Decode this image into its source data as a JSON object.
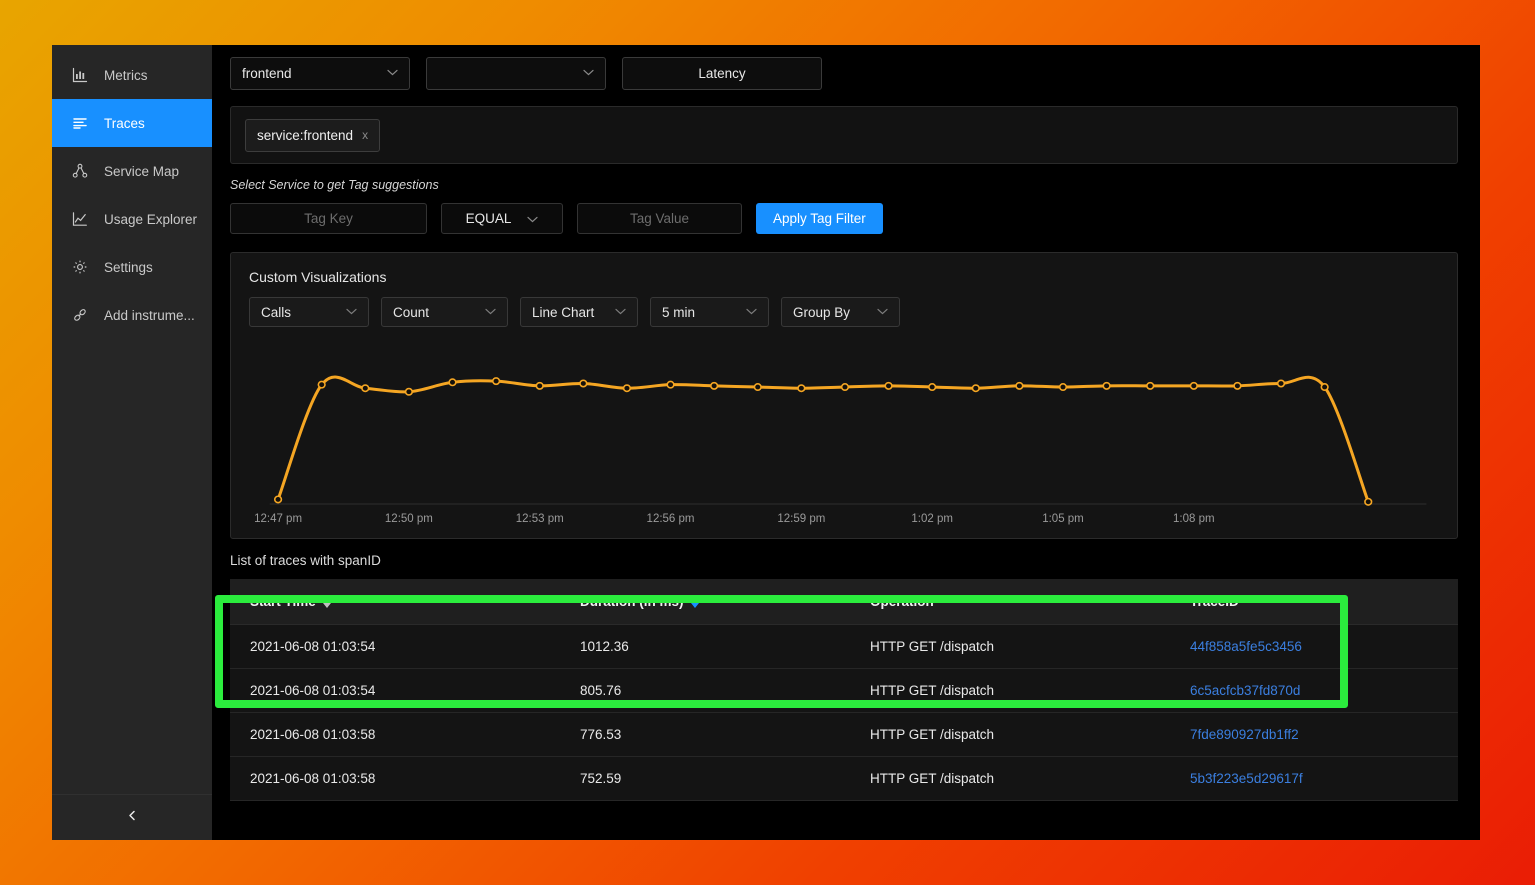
{
  "sidebar": {
    "items": [
      {
        "label": "Metrics",
        "icon": "bar-chart-icon",
        "active": false
      },
      {
        "label": "Traces",
        "icon": "list-lines-icon",
        "active": true
      },
      {
        "label": "Service Map",
        "icon": "node-graph-icon",
        "active": false
      },
      {
        "label": "Usage Explorer",
        "icon": "line-chart-icon",
        "active": false
      },
      {
        "label": "Settings",
        "icon": "gear-icon",
        "active": false
      },
      {
        "label": "Add instrume...",
        "icon": "link-chain-icon",
        "active": false
      }
    ],
    "collapse_icon": "chevron-left-icon"
  },
  "filters": {
    "service_value": "frontend",
    "operation_value": "",
    "latency_label": "Latency",
    "caret_icon": "chevron-down-icon",
    "chips": [
      {
        "label": "service:frontend",
        "close_icon": "x"
      }
    ]
  },
  "tag_filter": {
    "hint": "Select Service to get Tag suggestions",
    "tag_key_placeholder": "Tag Key",
    "tag_key_value": "",
    "operator_value": "EQUAL",
    "tag_value_placeholder": "Tag Value",
    "tag_value_value": "",
    "apply_label": "Apply Tag Filter",
    "apply_color": "#1890ff"
  },
  "visualization": {
    "title": "Custom Visualizations",
    "metric_value": "Calls",
    "aggregate_value": "Count",
    "chart_type_value": "Line Chart",
    "interval_value": "5 min",
    "groupby_value": "Group By"
  },
  "chart_data": {
    "type": "line",
    "title": "",
    "xlabel": "",
    "ylabel": "",
    "line_color": "#f5a623",
    "marker_color": "#f5a623",
    "grid": false,
    "legend": null,
    "xlim": [
      0,
      26
    ],
    "ylim": [
      0,
      12
    ],
    "x_tick_labels": [
      "12:47 pm",
      "12:50 pm",
      "12:53 pm",
      "12:56 pm",
      "12:59 pm",
      "1:02 pm",
      "1:05 pm",
      "1:08 pm"
    ],
    "x_tick_positions": [
      0,
      3,
      6,
      9,
      12,
      15,
      18,
      21
    ],
    "series": [
      {
        "name": "Calls",
        "x": [
          0,
          1,
          2,
          3,
          4,
          5,
          6,
          7,
          8,
          9,
          10,
          11,
          12,
          13,
          14,
          15,
          16,
          17,
          18,
          19,
          20,
          21,
          22,
          23,
          24,
          25
        ],
        "values": [
          0.3,
          10.0,
          9.7,
          9.4,
          10.2,
          10.3,
          9.9,
          10.1,
          9.7,
          10.0,
          9.9,
          9.8,
          9.7,
          9.8,
          9.9,
          9.8,
          9.7,
          9.9,
          9.8,
          9.9,
          9.9,
          9.9,
          9.9,
          10.1,
          9.8,
          0.1
        ]
      }
    ]
  },
  "traces": {
    "caption": "List of traces with spanID",
    "columns": [
      {
        "key": "start_time",
        "label": "Start Time",
        "sortable": true,
        "sort_active": false
      },
      {
        "key": "duration",
        "label": "Duration (in ms)",
        "sortable": true,
        "sort_active": true
      },
      {
        "key": "operation",
        "label": "Operation",
        "sortable": false,
        "sort_active": false
      },
      {
        "key": "trace_id",
        "label": "TraceID",
        "sortable": false,
        "sort_active": false
      }
    ],
    "rows": [
      {
        "start_time": "2021-06-08 01:03:54",
        "duration": "1012.36",
        "operation": "HTTP GET /dispatch",
        "trace_id": "44f858a5fe5c3456"
      },
      {
        "start_time": "2021-06-08 01:03:54",
        "duration": "805.76",
        "operation": "HTTP GET /dispatch",
        "trace_id": "6c5acfcb37fd870d"
      },
      {
        "start_time": "2021-06-08 01:03:58",
        "duration": "776.53",
        "operation": "HTTP GET /dispatch",
        "trace_id": "7fde890927db1ff2"
      },
      {
        "start_time": "2021-06-08 01:03:58",
        "duration": "752.59",
        "operation": "HTTP GET /dispatch",
        "trace_id": "5b3f223e5d29617f"
      }
    ]
  },
  "annotation": {
    "highlight_color": "#2bec3d"
  }
}
